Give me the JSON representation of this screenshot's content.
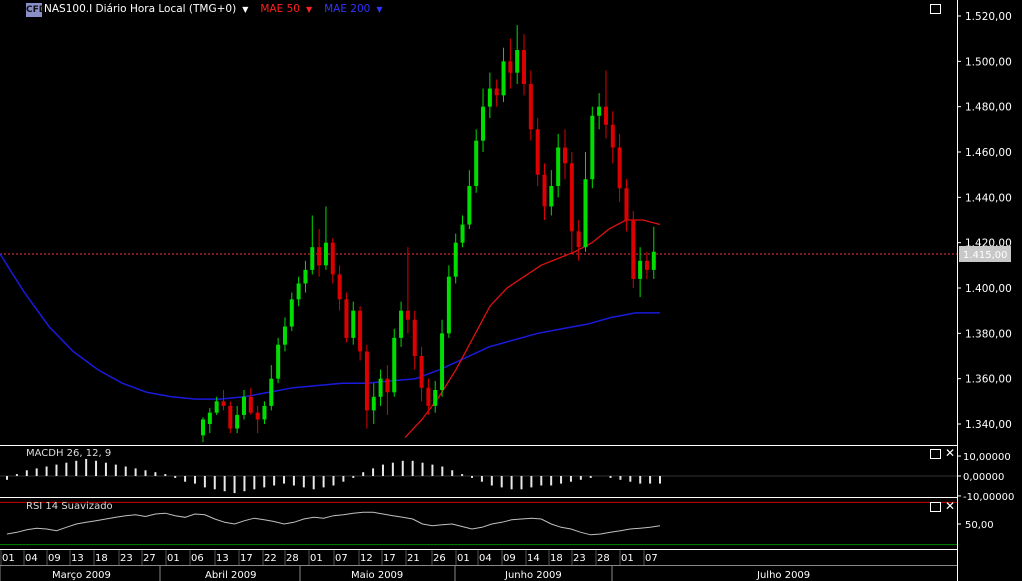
{
  "header": {
    "logo_text": "CFD",
    "symbol": "NAS100.I Diário Hora Local (TMG+0)",
    "indicator1": "MAE 50",
    "indicator2": "MAE 200",
    "dropdown_glyph": "▼"
  },
  "colors": {
    "up": "#00dd00",
    "down": "#dd0000",
    "mae50": "#dd1111",
    "mae200": "#1a1adc",
    "price_line": "#ff3333",
    "grid": "#808080"
  },
  "panels": {
    "macd": {
      "label": "MACDH 26, 12, 9",
      "ticks": [
        "10,00000",
        "0,00000",
        "-10,00000"
      ]
    },
    "rsi": {
      "label": "RSI 14 Suavizado",
      "ticks": [
        "50,00"
      ]
    }
  },
  "current_price_label": "1.415,00",
  "chart_data": {
    "type": "candlestick",
    "title": "NAS100.I Diário Hora Local (TMG+0)",
    "y_axis_ticks": [
      "1.520,00",
      "1.500,00",
      "1.480,00",
      "1.460,00",
      "1.440,00",
      "1.420,00",
      "1.400,00",
      "1.380,00",
      "1.360,00",
      "1.340,00"
    ],
    "ylim": [
      1334,
      1525
    ],
    "current_price": 1415,
    "day_labels": [
      "01",
      "04",
      "09",
      "13",
      "18",
      "23",
      "27",
      "01",
      "06",
      "13",
      "17",
      "22",
      "28",
      "01",
      "07",
      "12",
      "17",
      "21",
      "26",
      "01",
      "04",
      "09",
      "14",
      "18",
      "23",
      "28",
      "01",
      "07"
    ],
    "month_labels": [
      "Março 2009",
      "Abril 2009",
      "Maio 2009",
      "Junho 2009",
      "Julho 2009"
    ],
    "candles": [
      [
        1335,
        1342,
        1332,
        1343
      ],
      [
        1340,
        1345,
        1336,
        1347
      ],
      [
        1345,
        1350,
        1344,
        1352
      ],
      [
        1350,
        1348,
        1346,
        1355
      ],
      [
        1348,
        1338,
        1336,
        1350
      ],
      [
        1338,
        1344,
        1336,
        1348
      ],
      [
        1344,
        1352,
        1342,
        1355
      ],
      [
        1352,
        1345,
        1344,
        1356
      ],
      [
        1345,
        1342,
        1336,
        1348
      ],
      [
        1342,
        1348,
        1340,
        1350
      ],
      [
        1348,
        1360,
        1346,
        1366
      ],
      [
        1360,
        1375,
        1358,
        1378
      ],
      [
        1375,
        1383,
        1372,
        1387
      ],
      [
        1383,
        1395,
        1381,
        1398
      ],
      [
        1395,
        1402,
        1392,
        1405
      ],
      [
        1402,
        1408,
        1398,
        1412
      ],
      [
        1408,
        1418,
        1406,
        1432
      ],
      [
        1418,
        1410,
        1405,
        1426
      ],
      [
        1410,
        1420,
        1408,
        1436
      ],
      [
        1420,
        1406,
        1402,
        1422
      ],
      [
        1406,
        1395,
        1390,
        1410
      ],
      [
        1395,
        1378,
        1376,
        1398
      ],
      [
        1378,
        1390,
        1375,
        1394
      ],
      [
        1390,
        1372,
        1368,
        1392
      ],
      [
        1372,
        1346,
        1338,
        1375
      ],
      [
        1346,
        1352,
        1340,
        1358
      ],
      [
        1352,
        1360,
        1348,
        1364
      ],
      [
        1360,
        1354,
        1344,
        1366
      ],
      [
        1354,
        1378,
        1352,
        1382
      ],
      [
        1378,
        1390,
        1374,
        1394
      ],
      [
        1390,
        1386,
        1380,
        1418
      ],
      [
        1386,
        1370,
        1364,
        1390
      ],
      [
        1370,
        1356,
        1350,
        1374
      ],
      [
        1356,
        1348,
        1344,
        1360
      ],
      [
        1348,
        1355,
        1345,
        1359
      ],
      [
        1355,
        1380,
        1352,
        1386
      ],
      [
        1380,
        1405,
        1378,
        1410
      ],
      [
        1405,
        1420,
        1402,
        1424
      ],
      [
        1420,
        1428,
        1418,
        1432
      ],
      [
        1428,
        1445,
        1426,
        1452
      ],
      [
        1445,
        1465,
        1442,
        1470
      ],
      [
        1465,
        1480,
        1460,
        1488
      ],
      [
        1480,
        1488,
        1475,
        1495
      ],
      [
        1488,
        1485,
        1480,
        1492
      ],
      [
        1485,
        1500,
        1482,
        1506
      ],
      [
        1500,
        1495,
        1488,
        1510
      ],
      [
        1495,
        1505,
        1490,
        1516
      ],
      [
        1505,
        1490,
        1485,
        1512
      ],
      [
        1490,
        1470,
        1465,
        1496
      ],
      [
        1470,
        1450,
        1445,
        1475
      ],
      [
        1450,
        1436,
        1430,
        1455
      ],
      [
        1436,
        1445,
        1432,
        1452
      ],
      [
        1445,
        1462,
        1440,
        1468
      ],
      [
        1462,
        1455,
        1448,
        1470
      ],
      [
        1455,
        1425,
        1415,
        1460
      ],
      [
        1425,
        1418,
        1412,
        1430
      ],
      [
        1418,
        1448,
        1416,
        1460
      ],
      [
        1448,
        1476,
        1444,
        1480
      ],
      [
        1476,
        1480,
        1470,
        1486
      ],
      [
        1480,
        1472,
        1466,
        1496
      ],
      [
        1472,
        1462,
        1455,
        1478
      ],
      [
        1462,
        1444,
        1438,
        1468
      ],
      [
        1444,
        1430,
        1425,
        1448
      ],
      [
        1430,
        1404,
        1400,
        1434
      ],
      [
        1404,
        1412,
        1396,
        1418
      ],
      [
        1412,
        1408,
        1404,
        1416
      ],
      [
        1408,
        1416,
        1404,
        1427
      ]
    ],
    "mae50": [
      1334,
      1342,
      1352,
      1364,
      1378,
      1392,
      1400,
      1405,
      1410,
      1413,
      1416,
      1420,
      1426,
      1430,
      1430,
      1428
    ],
    "mae200": [
      1415,
      1398,
      1383,
      1372,
      1364,
      1358,
      1354,
      1352,
      1351,
      1351,
      1352,
      1354,
      1356,
      1357,
      1358,
      1358,
      1359,
      1360,
      1364,
      1369,
      1374,
      1377,
      1380,
      1382,
      1384,
      1387,
      1389,
      1389
    ],
    "macd_hist": [
      -2,
      1,
      3,
      4,
      5,
      6,
      7,
      8,
      9,
      8,
      7,
      6,
      5,
      4,
      3,
      2,
      1,
      -1,
      -3,
      -4,
      -6,
      -7,
      -8,
      -9,
      -8,
      -7,
      -6,
      -5,
      -4,
      -5,
      -6,
      -7,
      -6,
      -5,
      -3,
      -1,
      2,
      4,
      6,
      7,
      8,
      8,
      7,
      6,
      5,
      3,
      1,
      -1,
      -3,
      -5,
      -6,
      -7,
      -7,
      -6,
      -5,
      -5,
      -4,
      -3,
      -2,
      -1,
      0,
      -1,
      -2,
      -3,
      -4,
      -4,
      -4
    ],
    "rsi": [
      38,
      40,
      43,
      45,
      44,
      42,
      46,
      50,
      52,
      54,
      56,
      58,
      60,
      61,
      59,
      62,
      63,
      60,
      58,
      62,
      61,
      56,
      52,
      50,
      54,
      57,
      55,
      53,
      50,
      52,
      56,
      58,
      57,
      60,
      61,
      63,
      64,
      64,
      62,
      60,
      58,
      56,
      50,
      48,
      49,
      50,
      47,
      44,
      46,
      50,
      52,
      55,
      56,
      57,
      56,
      50,
      46,
      44,
      40,
      37,
      38,
      40,
      42,
      44,
      45,
      46,
      48
    ]
  }
}
